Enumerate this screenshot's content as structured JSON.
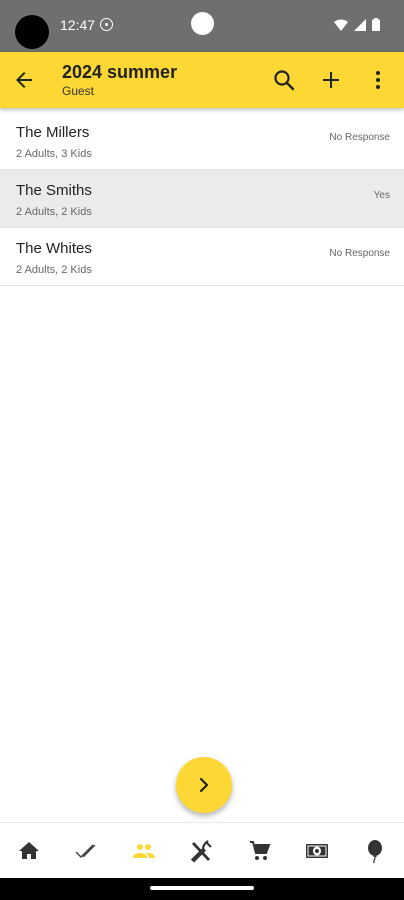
{
  "status_bar": {
    "time": "12:47",
    "icons": [
      "sync-icon",
      "wifi-icon",
      "signal-icon",
      "battery-icon"
    ]
  },
  "app_bar": {
    "title": "2024 summer",
    "subtitle": "Guest",
    "actions": [
      "back-arrow-icon",
      "search-icon",
      "add-icon",
      "more-vert-icon"
    ],
    "color": "#fdd835"
  },
  "guests": [
    {
      "name": "The Millers",
      "detail": "2 Adults, 3 Kids",
      "response": "No Response"
    },
    {
      "name": "The Smiths",
      "detail": "2 Adults, 2 Kids",
      "response": "Yes"
    },
    {
      "name": "The Whites",
      "detail": "2 Adults, 2 Kids",
      "response": "No Response"
    }
  ],
  "fab": {
    "icon": "chevron-right-icon"
  },
  "bottom_nav": {
    "items": [
      "home-icon",
      "checklist-icon",
      "guests-icon",
      "food-icon",
      "cart-icon",
      "budget-icon",
      "balloon-icon"
    ],
    "active": "guests-icon",
    "active_color": "#fdd835",
    "inactive_color": "#333333"
  }
}
